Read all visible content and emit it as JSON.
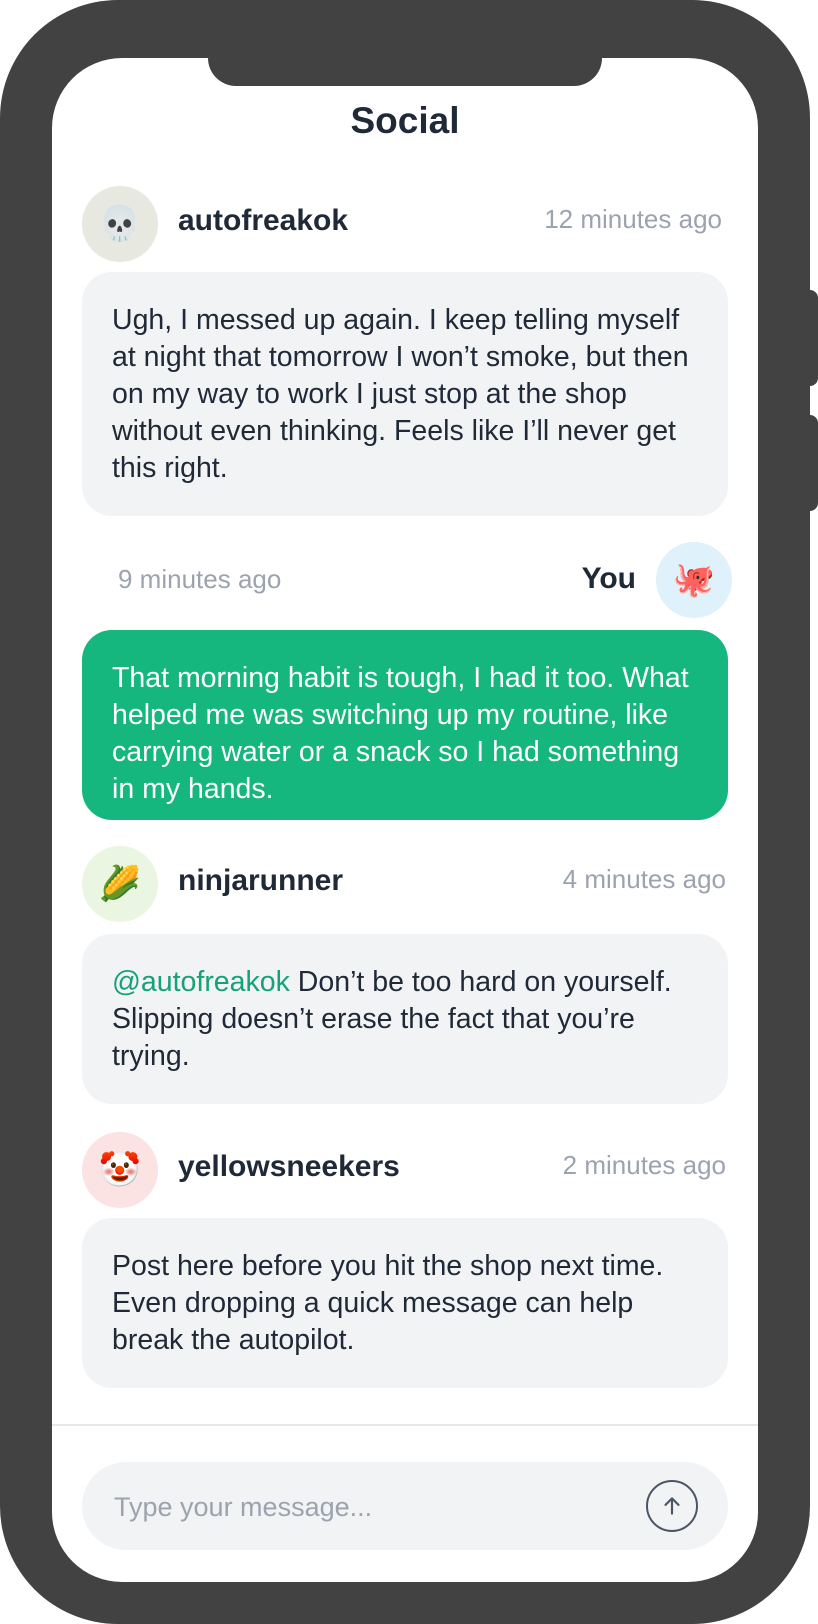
{
  "header": {
    "title": "Social"
  },
  "messages": [
    {
      "author": "autofreakok",
      "avatar_emoji": "💀",
      "avatar_bg": "#e7e9e1",
      "time": "12 minutes ago",
      "text": "Ugh, I messed up again. I keep telling myself at night that tomorrow I won’t smoke, but then on my way to work I just stop at the shop without even thinking. Feels like I’ll never get this right."
    },
    {
      "author": "You",
      "avatar_emoji": "🐙",
      "avatar_bg": "#dff1fb",
      "time": "9 minutes ago",
      "text": "That morning habit is tough, I had it too. What helped me was switching up my routine, like carrying water or a snack so I had something in my hands."
    },
    {
      "author": "ninjarunner",
      "avatar_emoji": "🌽",
      "avatar_bg": "#eaf6e1",
      "time": "4 minutes ago",
      "mention": "@autofreakok",
      "text": " Don’t be too hard on yourself. Slipping doesn’t erase the fact that you’re trying."
    },
    {
      "author": "yellowsneekers",
      "avatar_emoji": "🤡",
      "avatar_bg": "#fbe3e3",
      "time": "2 minutes ago",
      "text": "Post here before you hit the shop next time. Even dropping a quick message can help break the autopilot."
    }
  ],
  "composer": {
    "placeholder": "Type your message...",
    "send_icon": "arrow-up-icon"
  },
  "colors": {
    "accent": "#16b77e",
    "bubble_bg": "#f1f3f5",
    "frame": "#424242"
  }
}
